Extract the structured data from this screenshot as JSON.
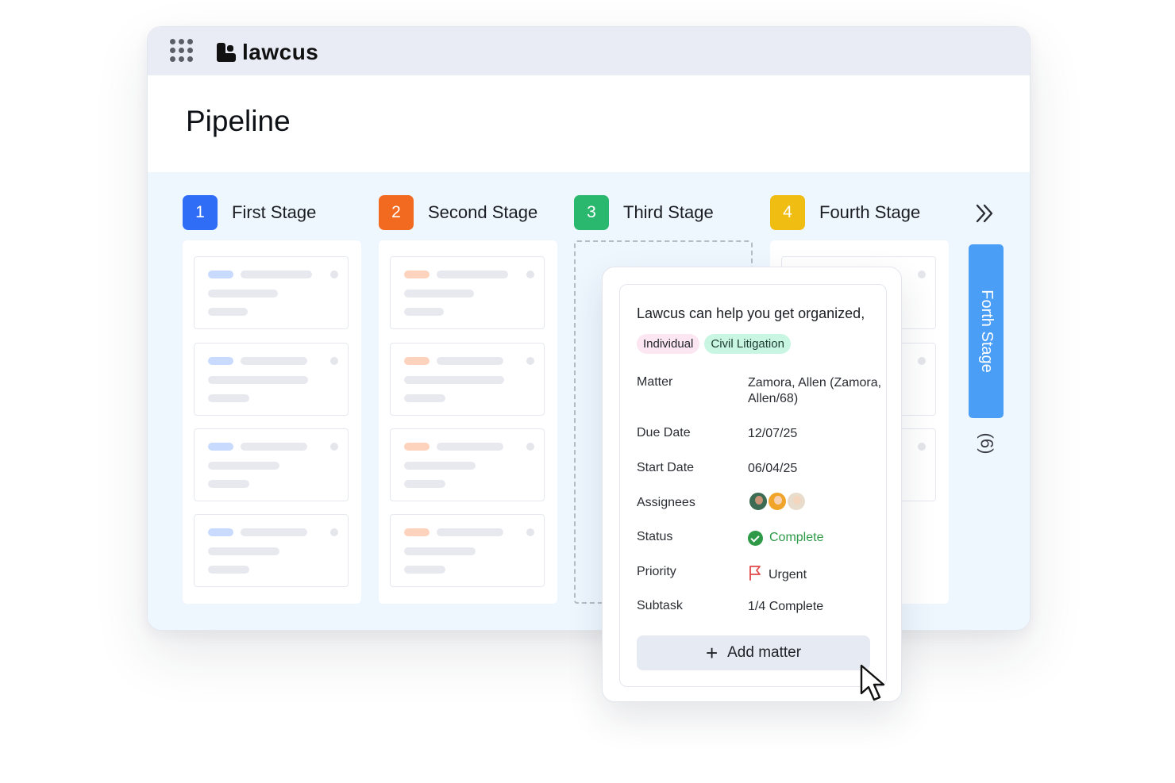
{
  "brand": {
    "name": "lawcus"
  },
  "page": {
    "title": "Pipeline"
  },
  "stages": [
    {
      "number": "1",
      "label": "First Stage",
      "color": "#2f6df6"
    },
    {
      "number": "2",
      "label": "Second Stage",
      "color": "#f26a20"
    },
    {
      "number": "3",
      "label": "Third Stage",
      "color": "#29b86d"
    },
    {
      "number": "4",
      "label": "Fourth Stage",
      "color": "#f0bd12"
    }
  ],
  "side_tab": {
    "label": "Forth Stage",
    "count": "(6)"
  },
  "colors": {
    "skeleton_blue": "#c8dafd",
    "skeleton_orange": "#fdd3bd",
    "side_tab": "#4a9ef5",
    "status_ok": "#2e9a47",
    "priority_flag": "#e24848"
  },
  "card": {
    "title": "Lawcus can help you get organized,",
    "tags": [
      "Individual",
      "Civil Litigation"
    ],
    "matter_label": "Matter",
    "matter_value": "Zamora, Allen (Zamora, Allen/68)",
    "due_label": "Due Date",
    "due_value": "12/07/25",
    "start_label": "Start Date",
    "start_value": "06/04/25",
    "assignees_label": "Assignees",
    "status_label": "Status",
    "status_value": "Complete",
    "priority_label": "Priority",
    "priority_value": "Urgent",
    "subtask_label": "Subtask",
    "subtask_value": "1/4 Complete",
    "add_button": "Add matter"
  }
}
